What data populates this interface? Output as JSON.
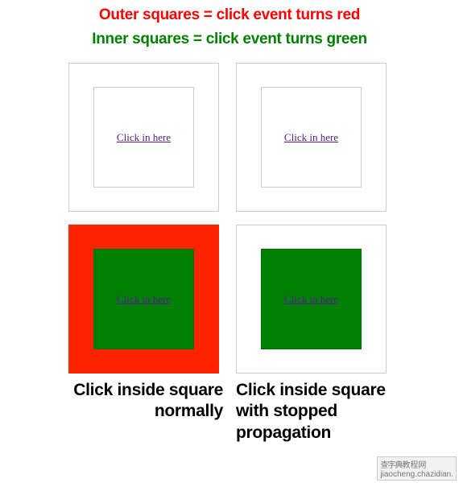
{
  "header": {
    "line1": "Outer squares = click event turns red",
    "line2": "Inner squares = click event turns green"
  },
  "squares": {
    "top_left": {
      "link": "Click in here",
      "outer_color": "white",
      "inner_color": "white"
    },
    "top_right": {
      "link": "Click in here",
      "outer_color": "white",
      "inner_color": "white"
    },
    "bottom_left": {
      "link": "Click in here",
      "outer_color": "red",
      "inner_color": "green"
    },
    "bottom_right": {
      "link": "Click in here",
      "outer_color": "white",
      "inner_color": "green"
    }
  },
  "captions": {
    "left_line1": "Click inside square",
    "left_line2": "normally",
    "right_line1": "Click inside square",
    "right_line2": "with stopped propagation"
  },
  "watermark": {
    "cn": "查字典",
    "suffix": "教程网",
    "url": "jiaocheng.chazidian."
  }
}
